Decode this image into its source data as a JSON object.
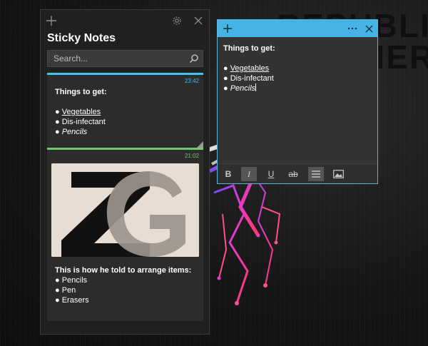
{
  "panel": {
    "title": "Sticky Notes",
    "search_placeholder": "Search..."
  },
  "notes": [
    {
      "time": "23:42",
      "heading": "Things to get:",
      "items": [
        "Vegetables",
        "Dis-infectant",
        "Pencils"
      ],
      "accent": "#44c2ee"
    },
    {
      "time": "21:02",
      "heading": "This is how he told to arrange items:",
      "items": [
        "Pencils",
        "Pen",
        "Erasers"
      ],
      "image_letters": "ZG",
      "accent": "#6fc86a"
    }
  ],
  "editor": {
    "heading": "Things to get:",
    "items": [
      "Vegetables",
      "Dis-infectant",
      "Pencils"
    ],
    "toolbar": {
      "bold": "B",
      "italic": "I",
      "underline": "U",
      "strike": "ab"
    }
  },
  "background": {
    "logo_lines": [
      "REPUBLIC",
      "GAMERS"
    ]
  },
  "colors": {
    "note_blue": "#45b4e4",
    "note_green": "#6fc86a",
    "panel_bg": "#202020"
  }
}
